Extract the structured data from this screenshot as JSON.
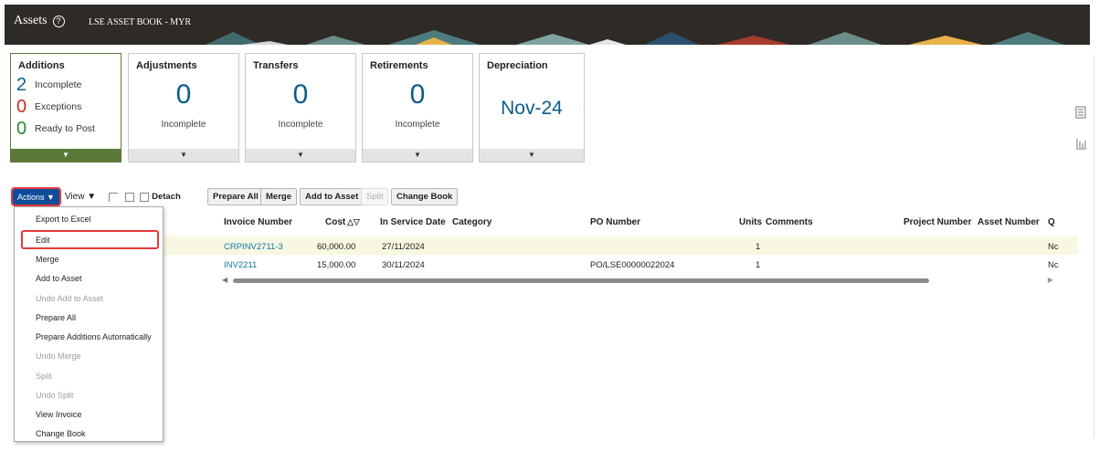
{
  "header": {
    "title": "Assets",
    "help_icon": "?",
    "book": "LSE ASSET BOOK - MYR"
  },
  "cards": {
    "additions": {
      "title": "Additions",
      "rows": [
        {
          "num": "2",
          "label": "Incomplete",
          "color": "#0d5d8a"
        },
        {
          "num": "0",
          "label": "Exceptions",
          "color": "#d02b20"
        },
        {
          "num": "0",
          "label": "Ready to Post",
          "color": "#2b8a2b"
        }
      ],
      "chevron": "▼"
    },
    "adjustments": {
      "title": "Adjustments",
      "value": "0",
      "label": "Incomplete",
      "chevron": "▼"
    },
    "transfers": {
      "title": "Transfers",
      "value": "0",
      "label": "Incomplete",
      "chevron": "▼"
    },
    "retirements": {
      "title": "Retirements",
      "value": "0",
      "label": "Incomplete",
      "chevron": "▼"
    },
    "depreciation": {
      "title": "Depreciation",
      "value": "Nov-24",
      "chevron": "▼"
    }
  },
  "toolbar": {
    "actions": "Actions ▼",
    "view": "View ▼",
    "detach": "Detach",
    "prepare_all": "Prepare All",
    "merge": "Merge",
    "add_to_asset": "Add to Asset",
    "split": "Split",
    "change_book": "Change Book"
  },
  "menu": {
    "export": "Export to Excel",
    "edit": "Edit",
    "merge": "Merge",
    "add_to_asset": "Add to Asset",
    "undo_add": "Undo Add to Asset",
    "prepare_all": "Prepare All",
    "prepare_auto": "Prepare Additions Automatically",
    "undo_merge": "Undo Merge",
    "split": "Split",
    "undo_split": "Undo Split",
    "view_invoice": "View Invoice",
    "change_book": "Change Book"
  },
  "table": {
    "headers": {
      "invoice": "Invoice Number",
      "cost": "Cost",
      "sort": "△▽",
      "in_service": "In Service Date",
      "category": "Category",
      "po": "PO Number",
      "units": "Units",
      "comments": "Comments",
      "project": "Project Number",
      "asset": "Asset Number",
      "q": "Q"
    },
    "rows": [
      {
        "invoice": "CRPINV2711-3",
        "cost": "60,000.00",
        "date": "27/11/2024",
        "po": "",
        "units": "1",
        "q": "Nc"
      },
      {
        "invoice": "INV2211",
        "cost": "15,000.00",
        "date": "30/11/2024",
        "po": "PO/LSE00000022024",
        "units": "1",
        "q": "Nc"
      }
    ],
    "scroll_left": "◀",
    "scroll_right": "▶"
  },
  "colors": {
    "header_bg": "#2e2a25",
    "accent_blue": "#0f4d9b",
    "selected_card": "#5b7a3a",
    "highlight_red": "#e23b3b"
  }
}
